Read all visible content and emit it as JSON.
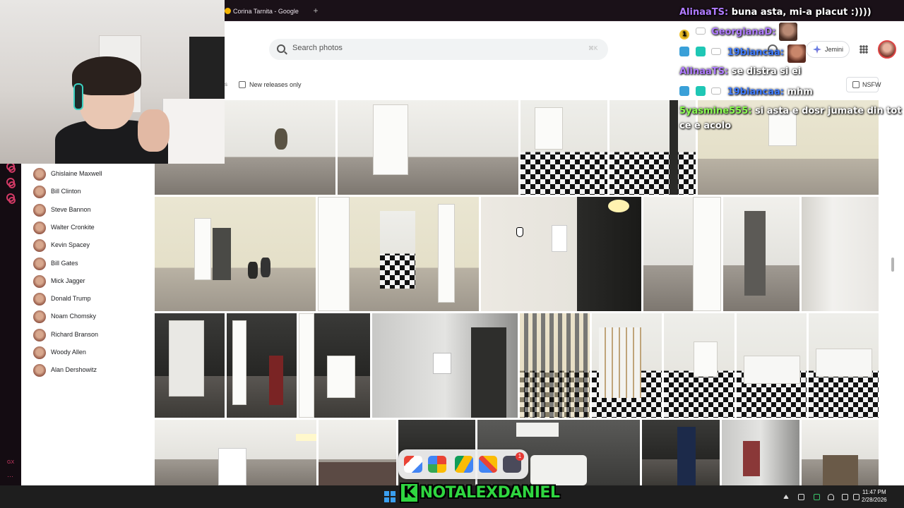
{
  "browser": {
    "tab_title": "Corina Tarnita - Google Se",
    "tab_new_symbol": "+"
  },
  "search": {
    "placeholder": "Search photos",
    "shortcut": "⌘K"
  },
  "header": {
    "assistant_label": "Jemini"
  },
  "filters": {
    "new_releases_label": "New releases only",
    "nsfw_label": "NSFW",
    "truncated_label": "s"
  },
  "sidebar": {
    "people": [
      "Ghislaine Maxwell",
      "Bill Clinton",
      "Steve Bannon",
      "Walter Cronkite",
      "Kevin Spacey",
      "Bill Gates",
      "Mick Jagger",
      "Donald Trump",
      "Noam Chomsky",
      "Richard Branson",
      "Woody Allen",
      "Alan Dershowitz"
    ]
  },
  "chat": {
    "messages": [
      {
        "user": "AlinaaTS:",
        "text": "buna asta, mi-a placut :))))"
      },
      {
        "user": "GeorgianaD:",
        "text": "",
        "badge_number": "1"
      },
      {
        "user": "19biancaa:",
        "text": ""
      },
      {
        "user": "AlinaaTS:",
        "text": "se distra si ei"
      },
      {
        "user": "19biancaa:",
        "text": "mhm"
      },
      {
        "user": "5yasmine555:",
        "text": "si asta e dosr jumate din tot"
      },
      {
        "user": "",
        "text": "ce e acolo"
      }
    ]
  },
  "dock": {
    "badge_count": "1"
  },
  "stream": {
    "banner_k": "K",
    "banner_rest": "NOTALEXDANIEL"
  },
  "taskbar": {
    "time": "11:47 PM",
    "date": "2/28/2026"
  },
  "rail": {
    "bottom_label": "GX",
    "more": "···"
  },
  "colors": {
    "accent": "#d43a66",
    "chat_purple": "#b07bff",
    "chat_blue": "#3e7bff",
    "chat_green": "#8bff52",
    "banner_green": "#2fd640"
  }
}
